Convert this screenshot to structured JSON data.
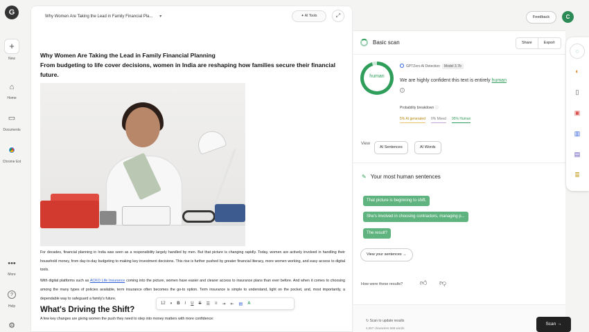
{
  "rail": {
    "new_label": "New",
    "home_label": "Home",
    "documents_label": "Documents",
    "chrome_label": "Chrome Ext",
    "more_label": "More",
    "help_label": "Help"
  },
  "document": {
    "title_select": "Why Women Are Taking the Lead in Family Financial Pla...",
    "ai_tools_label": "AI Tools",
    "heading": "Why Women Are Taking the Lead in Family Financial Planning",
    "subheading": "From budgeting to life cover decisions, women in India are reshaping how families secure their financial future.",
    "paragraph1": "For decades, financial planning in India was seen as a responsibility largely handled by men. But that picture is changing rapidly. Today, women are actively involved in handling their household money, from day-to-day budgeting to making key investment decisions. This rise is further pushed by greater financial literacy, more women working, and easy access to digital tools.",
    "paragraph2_before_link": "With digital platforms such as ",
    "link_text": "ACKO Life Insurance",
    "paragraph2_after_link": " coming into the picture, women have easier and clearer access to insurance plans than ever before. And when it comes to choosing among the many types of policies available, term insurance often becomes the go-to option. Term insurance is simple to understand, light on the pocket, and, most importantly, a dependable way to safeguard a family's future.",
    "section_heading": "What's Driving the Shift?",
    "paragraph3": "A few key changes are giving women the push they need to step into money matters with more confidence:"
  },
  "format_toolbar": {
    "font_size": "12",
    "bold": "B",
    "italic": "I",
    "underline": "U",
    "strike": "S"
  },
  "header": {
    "feedback_label": "Feedback",
    "avatar_letter": "C"
  },
  "scan": {
    "title": "Basic scan",
    "share_label": "Share",
    "export_label": "Export",
    "ring_label": "human",
    "ring_percent_human": 95,
    "detector_label": "GPTZero AI Detection",
    "model_label": "Model 3.7b",
    "confidence_prefix": "We are highly confident this text is entirely",
    "confidence_word": "human",
    "probability_label": "Probability breakdown",
    "ai_generated": "5% AI generated",
    "mixed": "0% Mixed",
    "human": "95% Human",
    "view_label": "View",
    "ai_sentences_label": "AI Sentences",
    "ai_words_label": "AI Words",
    "human_sentences_title": "Your most human sentences",
    "sentences": [
      "That picture is beginning to shift.",
      "She's involved in choosing contractors, managing p...",
      "The result?"
    ],
    "view_sentences_label": "View your sentences →",
    "feedback_question": "How were these results?",
    "autoscan_label": "Scan to update results",
    "chars_label": "4,067 characters 568 words",
    "scan_button_label": "Scan →"
  },
  "colors": {
    "accent_green": "#2f9e5b",
    "chip_green": "#5fb37e",
    "link_blue": "#2a5bd7"
  }
}
